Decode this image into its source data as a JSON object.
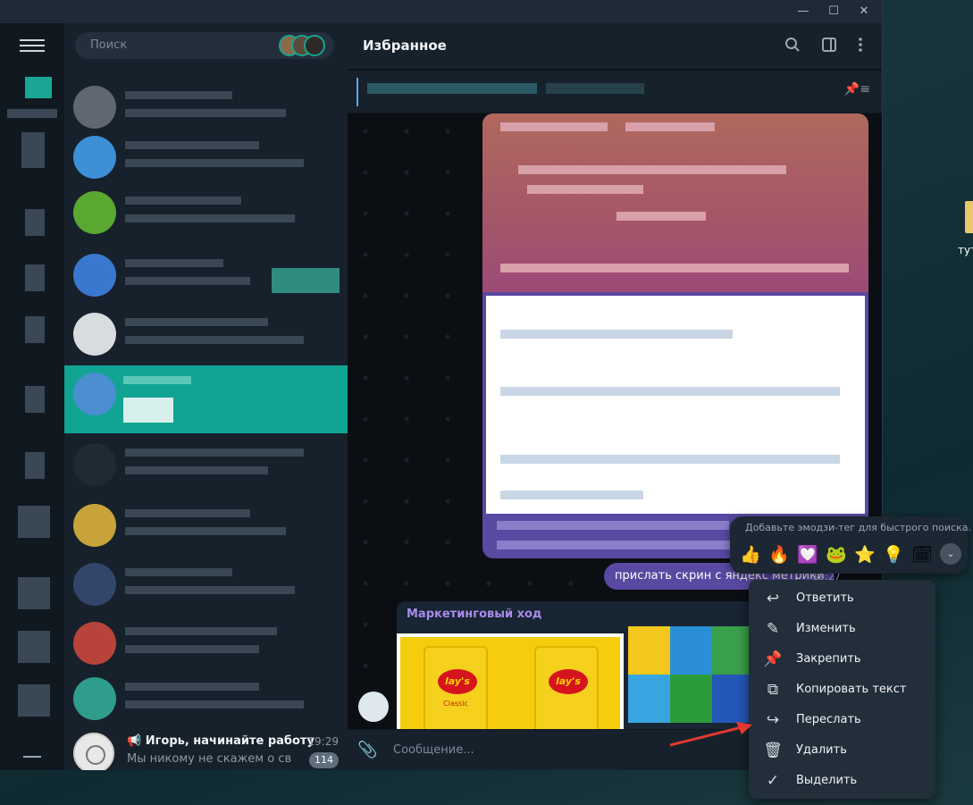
{
  "window": {
    "controls": {
      "minimize": "—",
      "maximize": "☐",
      "close": "✕"
    }
  },
  "desktop": {
    "file_label": "тут"
  },
  "search": {
    "placeholder": "Поиск"
  },
  "chat_list": {
    "last_chat": {
      "title": "📢 Игорь, начинайте работу",
      "time": "19:29",
      "preview": "Мы никому не скажем о св",
      "unread": "114"
    }
  },
  "chat": {
    "title": "Избранное",
    "message_text": "прислать скрин с яндекс метрики",
    "message_time": "19:27",
    "card_title": "Маркетинговый ход",
    "lays_logo": "lay's",
    "lays_variant": "Classic",
    "composer_placeholder": "Сообщение..."
  },
  "reactions": {
    "hint": "Добавьте эмодзи-тег для быстрого поиска.",
    "emojis": [
      "👍",
      "🔥",
      "💟",
      "🐸",
      "⭐",
      "💡",
      "🗓"
    ],
    "more": "⌄"
  },
  "context_menu": {
    "reply": "Ответить",
    "edit": "Изменить",
    "pin": "Закрепить",
    "copy": "Копировать текст",
    "forward": "Переслать",
    "delete": "Удалить",
    "select": "Выделить"
  },
  "colors": {
    "accent": "#11a493",
    "bubble": "#5a49a3",
    "panel": "#17212b",
    "card_title": "#a98bea"
  }
}
